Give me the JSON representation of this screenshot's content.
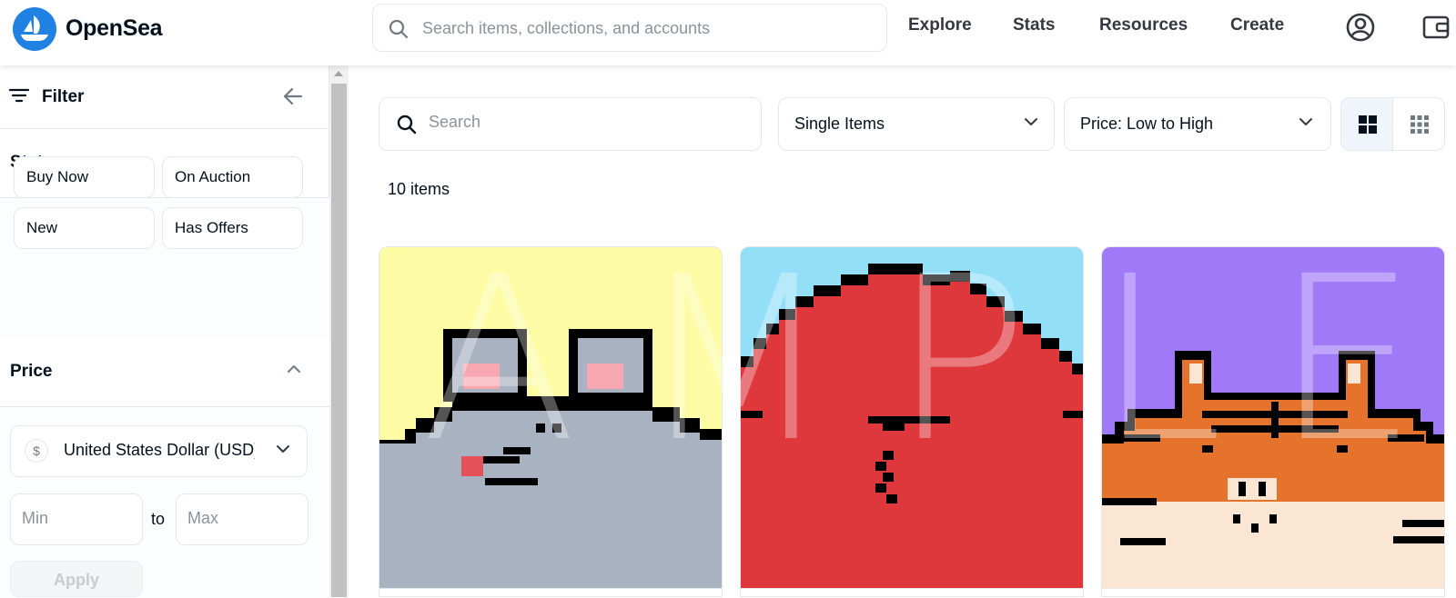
{
  "navbar": {
    "brand": "OpenSea",
    "search_placeholder": "Search items, collections, and accounts",
    "links": [
      "Explore",
      "Stats",
      "Resources",
      "Create"
    ],
    "icons": [
      "opensea-logo",
      "search-icon",
      "account-icon",
      "wallet-icon"
    ]
  },
  "sidebar": {
    "filter_title": "Filter",
    "status": {
      "title": "Status",
      "buttons": [
        "Buy Now",
        "On Auction",
        "New",
        "Has Offers"
      ]
    },
    "price": {
      "title": "Price",
      "currency_symbol": "$",
      "currency": "United States Dollar (USD)",
      "min_placeholder": "Min",
      "to": "to",
      "max_placeholder": "Max",
      "apply": "Apply"
    }
  },
  "main": {
    "search_placeholder": "Search",
    "type_dropdown": "Single Items",
    "sort_dropdown": "Price: Low to High",
    "item_count": "10 items",
    "watermark": [
      "A",
      "M",
      "P",
      "L",
      "E"
    ],
    "cards": [
      {
        "name": "nft-card-mouse",
        "background": "#fdfca4"
      },
      {
        "name": "nft-card-red-blob",
        "background": "#93dff8"
      },
      {
        "name": "nft-card-tiger",
        "background": "#9f79f7"
      }
    ]
  },
  "colors": {
    "brand_blue": "#2081e2",
    "text_primary": "#04111d",
    "border": "#e5e8eb",
    "placeholder": "#8a939b"
  }
}
